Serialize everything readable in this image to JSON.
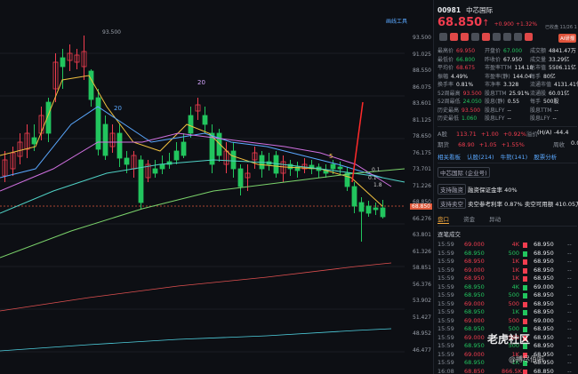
{
  "chart": {
    "price_labels": [
      "93.500",
      "91.025",
      "88.550",
      "86.075",
      "83.601",
      "81.125",
      "78.650",
      "76.175",
      "73.701",
      "71.226",
      "68.850",
      "66.276",
      "63.801",
      "61.326",
      "58.851",
      "56.376",
      "53.902",
      "51.427",
      "48.952",
      "46.477"
    ],
    "current_price_tag": "68.850",
    "hover_price": "93.500",
    "peak_label": "20",
    "ma_labels": [
      "20",
      "30",
      "5"
    ],
    "right_mini_labels": [
      "0.1",
      "0.1",
      "1.8"
    ]
  },
  "header": {
    "code": "00981",
    "name": "中芯国际",
    "price": "68.850",
    "arrow": "↑",
    "change": "+0.900",
    "change_pct": "+1.32%",
    "time": "已收盘 11/26 1",
    "ai_button": "AI研报"
  },
  "stats": [
    {
      "k": "最高价",
      "v": "69.950",
      "c": "red"
    },
    {
      "k": "开盘价",
      "v": "67.000",
      "c": "green"
    },
    {
      "k": "成交额",
      "v": "4841.47万",
      "c": "white"
    },
    {
      "k": "最低价",
      "v": "66.800",
      "c": "green"
    },
    {
      "k": "昨收价",
      "v": "67.950",
      "c": "white"
    },
    {
      "k": "成交量",
      "v": "33.29亿",
      "c": "white"
    },
    {
      "k": "平均价",
      "v": "68.675",
      "c": "red"
    },
    {
      "k": "市盈率TTM",
      "v": "114.18",
      "c": "white"
    },
    {
      "k": "总市值",
      "v": "5506.11亿",
      "c": "white"
    },
    {
      "k": "振幅",
      "v": "4.49%",
      "c": "white"
    },
    {
      "k": "市盈率(静)",
      "v": "144.04",
      "c": "white"
    },
    {
      "k": "每手",
      "v": "80亿",
      "c": "white"
    },
    {
      "k": "换手率",
      "v": "0.81%",
      "c": "white"
    },
    {
      "k": "市净率",
      "v": "3.328",
      "c": "white"
    },
    {
      "k": "流通市值",
      "v": "4131.41亿",
      "c": "white"
    },
    {
      "k": "52周最高",
      "v": "93.500",
      "c": "red"
    },
    {
      "k": "股息TTM",
      "v": "25.91%",
      "c": "white"
    },
    {
      "k": "流通股",
      "v": "60.01亿",
      "c": "white"
    },
    {
      "k": "52周最低",
      "v": "24.050",
      "c": "green"
    },
    {
      "k": "股息(静)",
      "v": "0.55",
      "c": "white"
    },
    {
      "k": "每手",
      "v": "500股",
      "c": "white"
    },
    {
      "k": "历史最高",
      "v": "93.500",
      "c": "red"
    },
    {
      "k": "股息LFY",
      "v": "--",
      "c": "white"
    },
    {
      "k": "股息TTM",
      "v": "--",
      "c": "white"
    },
    {
      "k": "历史最低",
      "v": "1.060",
      "c": "green"
    },
    {
      "k": "股息LFY",
      "v": "--",
      "c": "white"
    },
    {
      "k": "股息LFY",
      "v": "--",
      "c": "white"
    }
  ],
  "a_share": {
    "label": "A股",
    "price": "113.71",
    "change": "+1.00",
    "pct": "+0.92%",
    "premium_label": "溢价",
    "premium": "(H/A) -44.4"
  },
  "futures": {
    "label": "期货",
    "price": "68.90",
    "change": "+1.05",
    "pct": "+1.55%",
    "close_label": "周收",
    "close": "0.0"
  },
  "tabs1": [
    "相关看板",
    "认股(214)",
    "牛熊(141)",
    "股票分析"
  ],
  "company_tag": "中芯国际 (企业号)",
  "margin": {
    "label": "支持融资",
    "text": "融资保证金率 40%"
  },
  "short": {
    "label": "支持卖空",
    "text": "卖空参考利率 0.87% 卖空可用额 410.05万"
  },
  "tabs2": [
    "盘口",
    "资金",
    "异动"
  ],
  "ticker_title": "逐笔成交",
  "trades": [
    {
      "t": "15:59",
      "p": "69.000",
      "q": "4K",
      "d": "red",
      "p2": "68.950",
      "q2": "--"
    },
    {
      "t": "15:59",
      "p": "68.950",
      "q": "500",
      "d": "green",
      "p2": "68.950",
      "q2": "--"
    },
    {
      "t": "15:59",
      "p": "68.950",
      "q": "1K",
      "d": "red",
      "p2": "68.950",
      "q2": "--"
    },
    {
      "t": "15:59",
      "p": "69.000",
      "q": "1K",
      "d": "red",
      "p2": "68.950",
      "q2": "--"
    },
    {
      "t": "15:59",
      "p": "68.950",
      "q": "1K",
      "d": "red",
      "p2": "68.950",
      "q2": "--"
    },
    {
      "t": "15:59",
      "p": "68.950",
      "q": "4K",
      "d": "green",
      "p2": "69.000",
      "q2": "--"
    },
    {
      "t": "15:59",
      "p": "68.950",
      "q": "500",
      "d": "green",
      "p2": "68.950",
      "q2": "--"
    },
    {
      "t": "15:59",
      "p": "69.000",
      "q": "500",
      "d": "red",
      "p2": "68.950",
      "q2": "--"
    },
    {
      "t": "15:59",
      "p": "68.950",
      "q": "1K",
      "d": "green",
      "p2": "68.950",
      "q2": "--"
    },
    {
      "t": "15:59",
      "p": "69.000",
      "q": "500",
      "d": "red",
      "p2": "69.000",
      "q2": "--"
    },
    {
      "t": "15:59",
      "p": "68.950",
      "q": "500",
      "d": "green",
      "p2": "68.950",
      "q2": "--"
    },
    {
      "t": "15:59",
      "p": "69.000",
      "q": "500",
      "d": "red",
      "p2": "68.950",
      "q2": "--"
    },
    {
      "t": "15:59",
      "p": "68.950",
      "q": "500",
      "d": "green",
      "p2": "68.950",
      "q2": "--"
    },
    {
      "t": "15:59",
      "p": "69.000",
      "q": "1K",
      "d": "red",
      "p2": "68.950",
      "q2": "--"
    },
    {
      "t": "15:59",
      "p": "68.950",
      "q": "1K",
      "d": "green",
      "p2": "68.950",
      "q2": "--"
    },
    {
      "t": "16:08",
      "p": "68.850",
      "q": "866.5K",
      "d": "red",
      "p2": "68.850",
      "q2": "--"
    }
  ],
  "watermark": {
    "brand": "老虎社区",
    "user": "@搏尽佰啦"
  }
}
